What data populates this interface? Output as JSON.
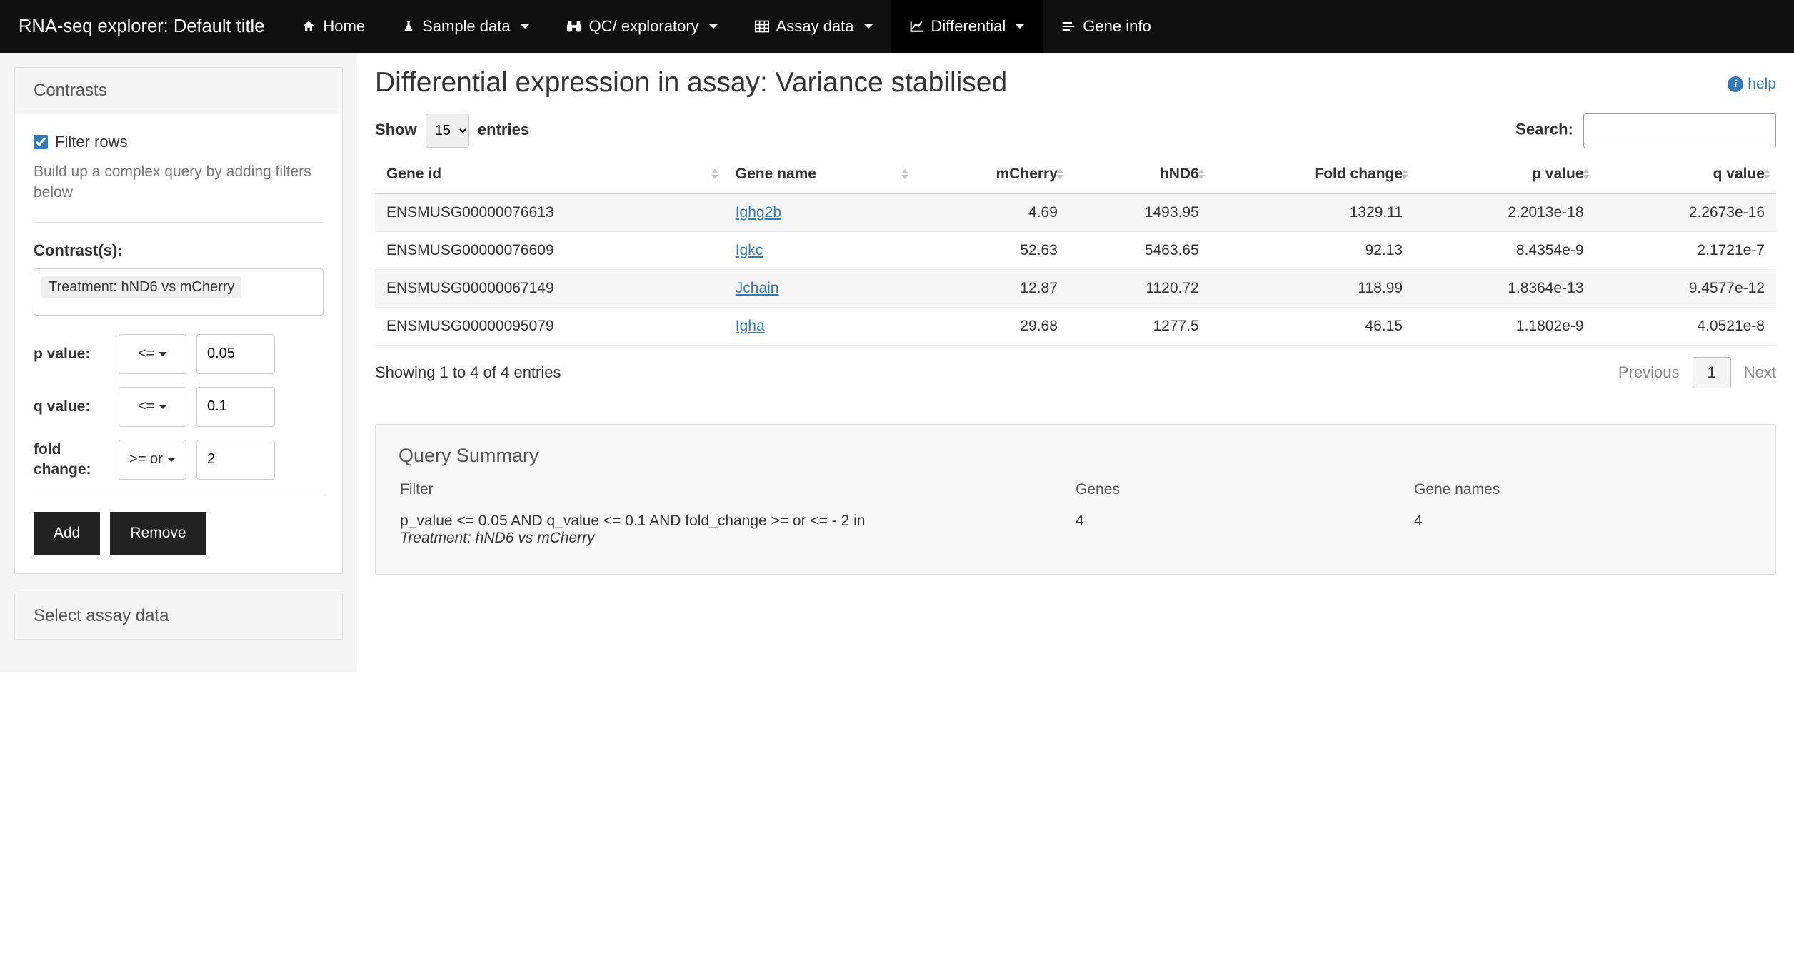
{
  "navbar": {
    "brand": "RNA-seq explorer: Default title",
    "items": [
      {
        "label": "Home",
        "icon": "home",
        "dropdown": false,
        "active": false
      },
      {
        "label": "Sample data",
        "icon": "flask",
        "dropdown": true,
        "active": false
      },
      {
        "label": "QC/ exploratory",
        "icon": "binoculars",
        "dropdown": true,
        "active": false
      },
      {
        "label": "Assay data",
        "icon": "table",
        "dropdown": true,
        "active": false
      },
      {
        "label": "Differential",
        "icon": "chart-line",
        "dropdown": true,
        "active": true
      },
      {
        "label": "Gene info",
        "icon": "bars-stagger",
        "dropdown": false,
        "active": false
      }
    ]
  },
  "sidebar": {
    "contrasts": {
      "title": "Contrasts",
      "filter_rows_label": "Filter rows",
      "filter_rows_checked": true,
      "help": "Build up a complex query by adding filters below",
      "contrast_label": "Contrast(s):",
      "contrast_value": "Treatment: hND6 vs mCherry",
      "filters": [
        {
          "label": "p value:",
          "op": "<=",
          "val": "0.05"
        },
        {
          "label": "q value:",
          "op": "<=",
          "val": "0.1"
        },
        {
          "label": "fold change:",
          "op": ">= or",
          "val": "2"
        }
      ],
      "add_button": "Add",
      "remove_button": "Remove"
    },
    "assay_panel_title": "Select assay data"
  },
  "main": {
    "title": "Differential expression in assay: Variance stabilised",
    "help_label": "help",
    "show_label_pre": "Show",
    "show_label_post": "entries",
    "show_value": "15",
    "search_label": "Search:",
    "search_value": "",
    "columns": [
      "Gene id",
      "Gene name",
      "mCherry",
      "hND6",
      "Fold change",
      "p value",
      "q value"
    ],
    "rows": [
      {
        "gene_id": "ENSMUSG00000076613",
        "gene_name": "Ighg2b",
        "mCherry": "4.69",
        "hND6": "1493.95",
        "fold_change": "1329.11",
        "p_value": "2.2013e-18",
        "q_value": "2.2673e-16"
      },
      {
        "gene_id": "ENSMUSG00000076609",
        "gene_name": "Igkc",
        "mCherry": "52.63",
        "hND6": "5463.65",
        "fold_change": "92.13",
        "p_value": "8.4354e-9",
        "q_value": "2.1721e-7"
      },
      {
        "gene_id": "ENSMUSG00000067149",
        "gene_name": "Jchain",
        "mCherry": "12.87",
        "hND6": "1120.72",
        "fold_change": "118.99",
        "p_value": "1.8364e-13",
        "q_value": "9.4577e-12"
      },
      {
        "gene_id": "ENSMUSG00000095079",
        "gene_name": "Igha",
        "mCherry": "29.68",
        "hND6": "1277.5",
        "fold_change": "46.15",
        "p_value": "1.1802e-9",
        "q_value": "4.0521e-8"
      }
    ],
    "info_text": "Showing 1 to 4 of 4 entries",
    "pager_prev": "Previous",
    "pager_page": "1",
    "pager_next": "Next",
    "summary": {
      "title": "Query Summary",
      "headers": [
        "Filter",
        "Genes",
        "Gene names"
      ],
      "row": {
        "filter_text": "p_value <= 0.05 AND q_value <= 0.1 AND fold_change >= or <= - 2 in ",
        "filter_em": "Treatment: hND6 vs mCherry",
        "genes": "4",
        "gene_names": "4"
      }
    }
  }
}
